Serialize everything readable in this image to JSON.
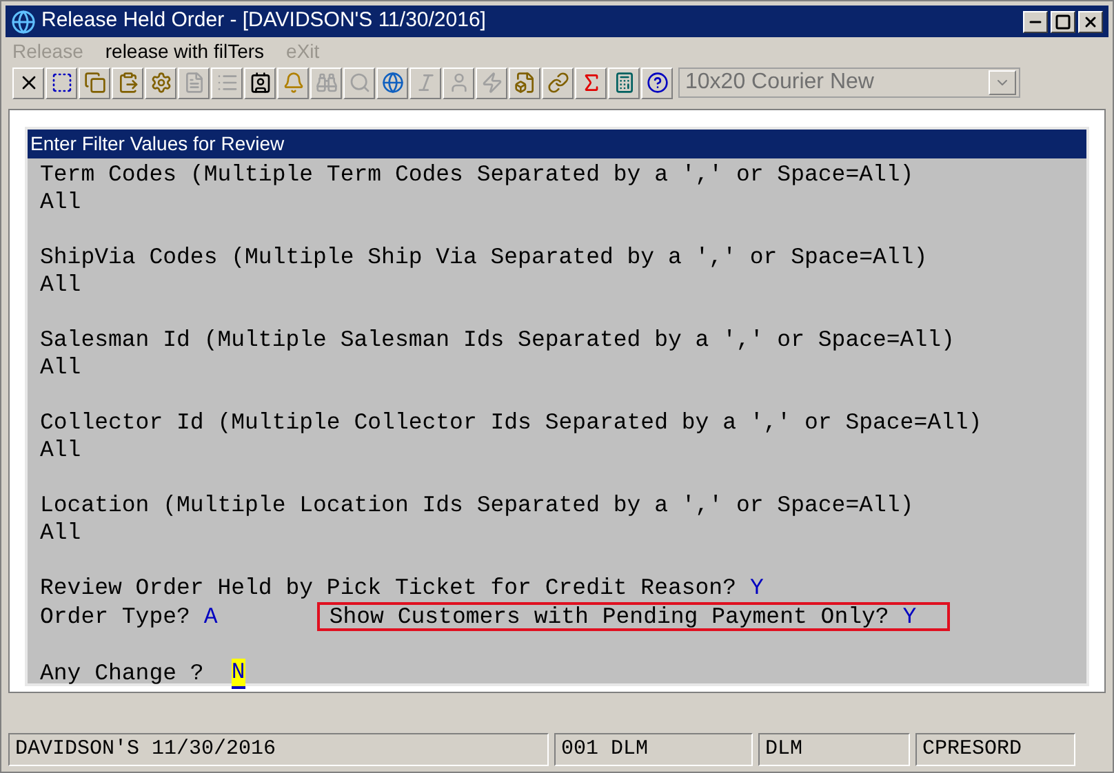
{
  "window": {
    "title": "Release Held Order - [DAVIDSON'S 11/30/2016]"
  },
  "menu": [
    {
      "label": "Release",
      "disabled": true
    },
    {
      "label": "release with filTers",
      "disabled": false
    },
    {
      "label": "eXit",
      "disabled": true
    }
  ],
  "toolbar": [
    {
      "kind": "close",
      "disabled": false
    },
    {
      "kind": "select",
      "disabled": false
    },
    {
      "kind": "copy",
      "disabled": false
    },
    {
      "kind": "paste",
      "disabled": false
    },
    {
      "kind": "gear",
      "disabled": false
    },
    {
      "kind": "document",
      "disabled": true
    },
    {
      "kind": "list",
      "disabled": true
    },
    {
      "kind": "contact",
      "disabled": false
    },
    {
      "kind": "bell",
      "disabled": false
    },
    {
      "kind": "binoculars",
      "disabled": true
    },
    {
      "kind": "search",
      "disabled": true
    },
    {
      "kind": "globe",
      "disabled": false
    },
    {
      "kind": "italic",
      "disabled": true
    },
    {
      "kind": "person",
      "disabled": true
    },
    {
      "kind": "bolt",
      "disabled": true
    },
    {
      "kind": "bolt-doc",
      "disabled": false
    },
    {
      "kind": "link",
      "disabled": false
    },
    {
      "kind": "function",
      "disabled": false
    },
    {
      "kind": "calculator",
      "disabled": false
    },
    {
      "kind": "help",
      "disabled": false
    }
  ],
  "font_select": {
    "value": "10x20 Courier New",
    "disabled": true
  },
  "panel": {
    "title": "Enter Filter Values for Review",
    "filters": [
      {
        "label": "Term Codes (Multiple Term Codes Separated by a ',' or Space=All)",
        "value": "All"
      },
      {
        "label": "ShipVia Codes (Multiple Ship Via Separated by a ',' or Space=All)",
        "value": "All"
      },
      {
        "label": "Salesman Id (Multiple Salesman Ids Separated by a ',' or Space=All)",
        "value": "All"
      },
      {
        "label": "Collector Id (Multiple Collector Ids Separated by a ',' or Space=All)",
        "value": "All"
      },
      {
        "label": "Location (Multiple Location Ids Separated by a ',' or Space=All)",
        "value": "All"
      }
    ],
    "credit_reason": {
      "label": "Review Order Held by Pick Ticket for Credit Reason?",
      "value": "Y"
    },
    "order_type": {
      "label": "Order Type?",
      "value": "A"
    },
    "pending_payment": {
      "label": "Show Customers with Pending Payment Only?",
      "value": "Y",
      "highlighted": true
    },
    "any_change": {
      "label": "Any Change ?",
      "value": "N",
      "focused": true
    }
  },
  "status_bar": [
    "DAVIDSON'S 11/30/2016",
    "001 DLM",
    "DLM",
    "CPRESORD"
  ]
}
